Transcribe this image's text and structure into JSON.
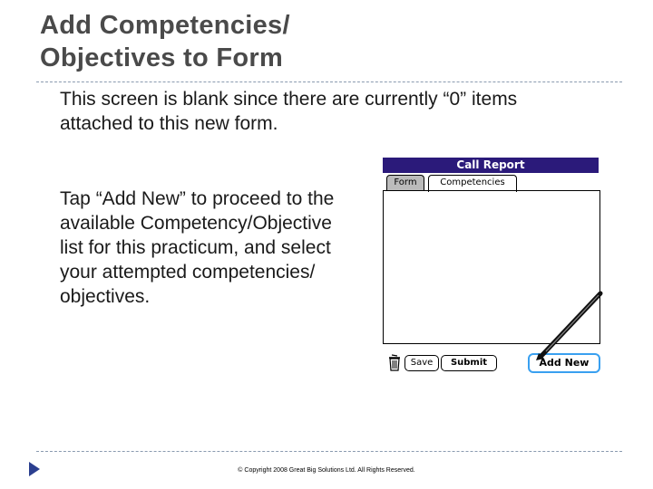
{
  "slide": {
    "title": "Add Competencies/ Objectives to Form",
    "bullets": [
      "This screen is blank since there are currently “0” items attached to this new form.",
      "Tap “Add New” to proceed to the available Competency/Objective list for this practicum, and select your attempted competencies/ objectives."
    ],
    "bullet_glyph": "",
    "footer": "© Copyright 2008 Great Big Solutions Ltd. All Rights Reserved."
  },
  "palm": {
    "header_title": "Call Report",
    "tabs": [
      "Form",
      "Competencies"
    ],
    "active_tab": "Competencies",
    "buttons": {
      "save": "Save",
      "submit": "Submit",
      "add_new": "Add New"
    }
  },
  "colors": {
    "header_bg": "#2b1a7a",
    "accent": "#39a0f0",
    "title_text": "#4a4a4a"
  }
}
